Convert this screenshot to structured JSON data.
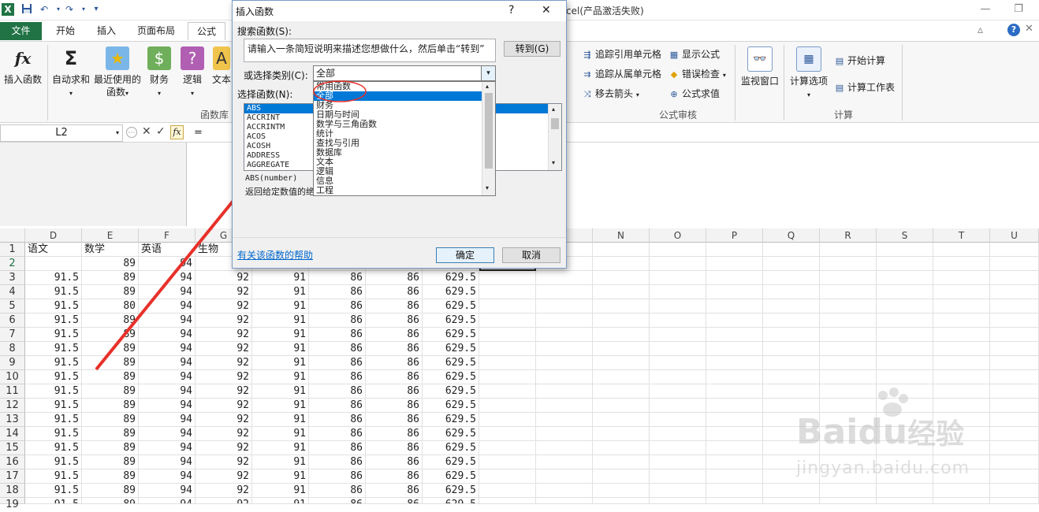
{
  "window": {
    "title": "cel(产品激活失败)",
    "quick_access": [
      "save-icon",
      "undo-icon",
      "redo-icon",
      "customize-icon"
    ]
  },
  "tabs": [
    "文件",
    "开始",
    "插入",
    "页面布局",
    "公式"
  ],
  "ribbon": {
    "insert_function": "插入函数",
    "autosum": "自动求和",
    "recently_used_1": "最近使用的",
    "recently_used_2": "函数",
    "financial": "财务",
    "logical": "逻辑",
    "text": "文本",
    "group_library": "函数库",
    "trace_precedents": "追踪引用单元格",
    "trace_dependents": "追踪从属单元格",
    "remove_arrows": "移去箭头",
    "show_formulas": "显示公式",
    "error_checking": "错误检查",
    "evaluate_formula": "公式求值",
    "watch_window": "监视窗口",
    "group_audit": "公式审核",
    "calc_options": "计算选项",
    "calc_now": "开始计算",
    "calc_sheet": "计算工作表",
    "group_calc": "计算"
  },
  "formula_bar": {
    "name_box": "L2",
    "formula": "="
  },
  "grid": {
    "columns_left": [
      "D",
      "E",
      "F",
      "G"
    ],
    "columns_right": [
      "N",
      "O",
      "P",
      "Q",
      "R",
      "S",
      "T",
      "U"
    ],
    "row_numbers": [
      "1",
      "2",
      "3",
      "4",
      "5",
      "6",
      "7",
      "8",
      "9",
      "10",
      "11",
      "12",
      "13",
      "14",
      "15",
      "16",
      "17",
      "18",
      "19"
    ],
    "header_row": [
      "语文",
      "数学",
      "英语",
      "生物"
    ],
    "row2": [
      "",
      "89",
      "94",
      "",
      "",
      "",
      "",
      ""
    ],
    "data_row": [
      "91.5",
      "89",
      "94",
      "92",
      "91",
      "86",
      "86",
      "629.5"
    ],
    "row6_e": "80"
  },
  "dialog": {
    "title": "插入函数",
    "help_btn": "?",
    "close_btn": "✕",
    "search_label": "搜索函数(S):",
    "search_placeholder": "请输入一条简短说明来描述您想做什么，然后单击“转到”",
    "go_button": "转到(G)",
    "category_label": "或选择类别(C):",
    "category_value": "全部",
    "function_label": "选择函数(N):",
    "functions": [
      "ABS",
      "ACCRINT",
      "ACCRINTM",
      "ACOS",
      "ACOSH",
      "ADDRESS",
      "AGGREGATE"
    ],
    "categories": [
      "常用函数",
      "全部",
      "财务",
      "日期与时间",
      "数学与三角函数",
      "统计",
      "查找与引用",
      "数据库",
      "文本",
      "逻辑",
      "信息",
      "工程"
    ],
    "signature": "ABS(number)",
    "description": "返回给定数值的绝",
    "help_link": "有关该函数的帮助",
    "ok": "确定",
    "cancel": "取消"
  },
  "watermark": {
    "brand": "Bai",
    "brand2": "du",
    "brand_cn": "经验",
    "url": "jingyan.baidu.com"
  },
  "colors": {
    "excel_green": "#217346",
    "highlight": "#0078d7",
    "annotation_red": "#e8302a"
  }
}
